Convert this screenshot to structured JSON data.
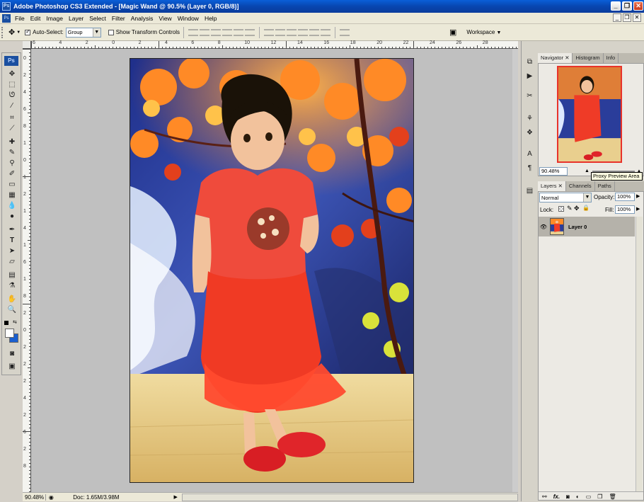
{
  "window": {
    "title": "Adobe Photoshop CS3 Extended - [Magic Wand @ 90.5% (Layer 0, RGB/8)]",
    "app_icon_label": "Ps"
  },
  "menu": [
    "File",
    "Edit",
    "Image",
    "Layer",
    "Select",
    "Filter",
    "Analysis",
    "View",
    "Window",
    "Help"
  ],
  "options_bar": {
    "auto_select_label": "Auto-Select:",
    "auto_select_checked": true,
    "auto_select_value": "Group",
    "show_transform_label": "Show Transform Controls",
    "show_transform_checked": false,
    "workspace_label": "Workspace"
  },
  "toolbox": {
    "logo": "Ps"
  },
  "rulers": {
    "horizontal": [
      "6",
      "4",
      "2",
      "0",
      "2",
      "4",
      "6",
      "8",
      "10",
      "12",
      "14",
      "16",
      "18",
      "20",
      "22",
      "24",
      "26",
      "28"
    ],
    "vertical": [
      "0",
      "2",
      "4",
      "6",
      "8",
      "1",
      "0",
      "1",
      "2",
      "1",
      "4",
      "1",
      "6",
      "1",
      "8",
      "2",
      "0",
      "2",
      "2",
      "2",
      "4",
      "2",
      "6",
      "2",
      "8"
    ]
  },
  "status_bar": {
    "zoom": "90.48%",
    "doc_info": "Doc: 1.65M/3.98M"
  },
  "navigator_panel": {
    "tabs": [
      "Navigator",
      "Histogram",
      "Info"
    ],
    "active_tab": "Navigator",
    "zoom_value": "90.48%",
    "tooltip": "Proxy Preview Area"
  },
  "layers_panel": {
    "tabs": [
      "Layers",
      "Channels",
      "Paths"
    ],
    "active_tab": "Layers",
    "blend_mode": "Normal",
    "opacity_label": "Opacity:",
    "opacity_value": "100%",
    "lock_label": "Lock:",
    "fill_label": "Fill:",
    "fill_value": "100%",
    "layers": [
      {
        "name": "Layer 0",
        "visible": true,
        "selected": true
      }
    ],
    "footer_icons": [
      "link-icon",
      "fx-icon",
      "mask-icon",
      "adjustment-icon",
      "group-icon",
      "new-layer-icon",
      "trash-icon"
    ]
  },
  "colors": {
    "titlebar": "#0a4fc4",
    "close_button": "#d8412a",
    "canvas_background": "#c0c0c0",
    "foreground_color": "#000000",
    "background_color": "#1a5fd0"
  }
}
